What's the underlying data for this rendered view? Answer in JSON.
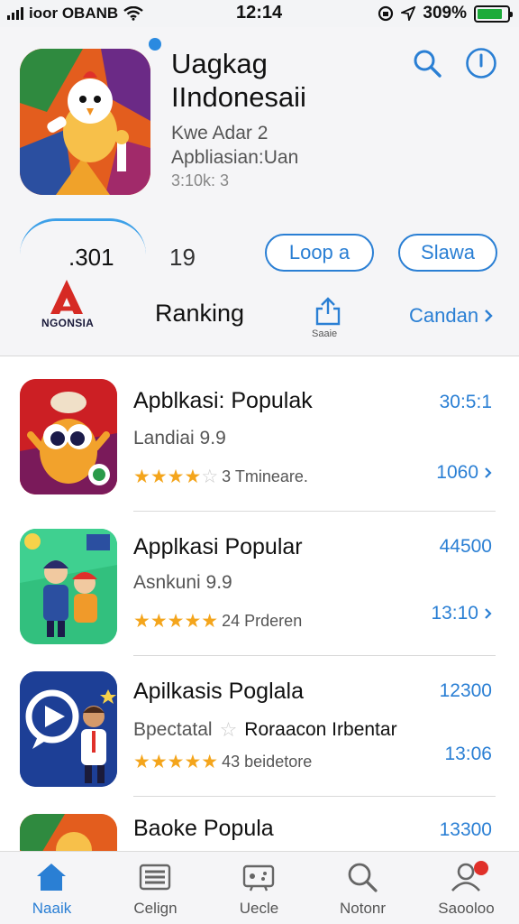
{
  "status_bar": {
    "carrier": "ioor OBANB",
    "time": "12:14",
    "battery": "309%",
    "battery_level": 0.85,
    "icons": [
      "signal-icon",
      "wifi-icon",
      "lock-rotation-icon",
      "location-icon",
      "battery-icon"
    ]
  },
  "header": {
    "app_title": "Uagkag IIndonesaii",
    "app_subtitle_1": "Kwe Adar 2",
    "app_subtitle_2": "Apbliasian:Uan",
    "app_size": "3:10k: 3",
    "stat_a": ".301",
    "stat_b": "19",
    "button_a": "Loop a",
    "button_b": "Slawa",
    "brand_text": "NGONSIA",
    "ranking_label": "Ranking",
    "share_label": "Saaie",
    "category_link": "Candan",
    "icons": [
      "search-icon",
      "info-icon",
      "share-icon",
      "chevron-right-icon"
    ]
  },
  "list": [
    {
      "title": "Apblkasi: Populak",
      "subtitle": "Landiai 9.9",
      "stars": 4,
      "rating_text": "3 Tmineare.",
      "num_top": "30:5:1",
      "num_bottom": "1060"
    },
    {
      "title": "Applkasi Popular",
      "subtitle": "Asnkuni 9.9",
      "stars": 5,
      "rating_text": "24 Prderen",
      "num_top": "44500",
      "num_bottom": "13:10"
    },
    {
      "title": "Apilkasis Poglala",
      "subtitle": "Bpectatal",
      "subtitle_extra": "Roraacon Irbentar",
      "stars": 5,
      "rating_text": "43 beidetore",
      "num_top": "12300",
      "num_bottom": "13:06"
    },
    {
      "title": "Baoke Popula",
      "num_top": "13300"
    }
  ],
  "tabbar": {
    "tabs": [
      {
        "label": "Naaik",
        "icon": "home-icon",
        "active": true
      },
      {
        "label": "Celign",
        "icon": "list-icon",
        "active": false
      },
      {
        "label": "Uecle",
        "icon": "games-icon",
        "active": false
      },
      {
        "label": "Notonr",
        "icon": "search-icon",
        "active": false
      },
      {
        "label": "Saooloo",
        "icon": "account-icon",
        "active": false
      }
    ]
  },
  "colors": {
    "accent": "#2a7fd4",
    "star": "#f4a51c",
    "badge": "#e0302a",
    "battery": "#1cab3a"
  }
}
